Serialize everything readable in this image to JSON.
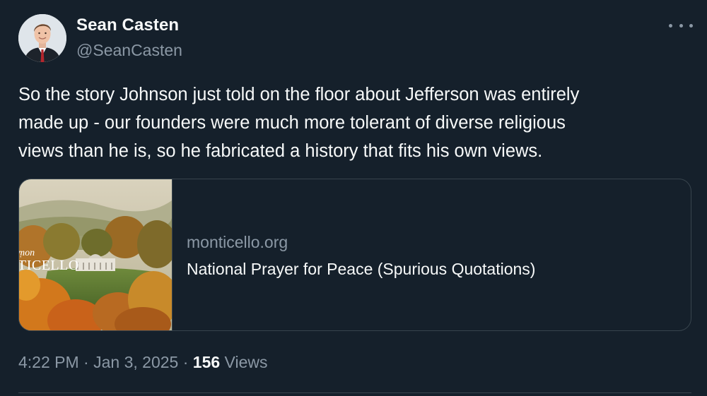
{
  "author": {
    "name": "Sean Casten",
    "handle": "@SeanCasten"
  },
  "tweet": {
    "text": "So the story Johnson just told on the floor about Jefferson was entirely\nmade up - our founders were much more tolerant of diverse religious\nviews than he is, so he fabricated a history that fits his own views."
  },
  "link_card": {
    "image_text_top": "ṃon",
    "image_text": "TICELLO",
    "domain": "monticello.org",
    "title": "National Prayer for Peace (Spurious Quotations)"
  },
  "meta": {
    "time": "4:22 PM",
    "separator_1": " · ",
    "date": "Jan 3, 2025",
    "separator_2": " · ",
    "views_count": "156",
    "views_label": " Views"
  },
  "icons": {
    "more": "more-dots-icon",
    "avatar": "avatar-photo"
  }
}
